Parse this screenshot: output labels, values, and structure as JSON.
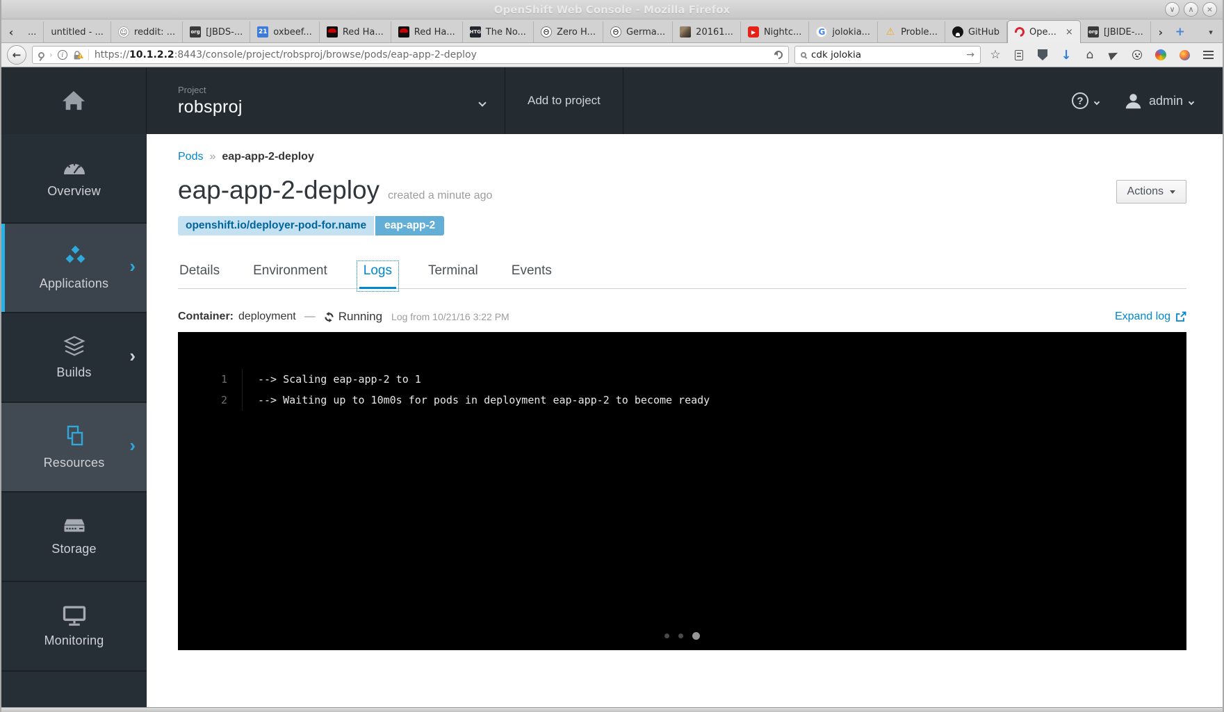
{
  "browser": {
    "window_title": "OpenShift Web Console - Mozilla Firefox",
    "window_controls": {
      "minimize": "∨",
      "maximize": "∧",
      "close": "×"
    },
    "tab_overflow": {
      "scroll_left": "‹",
      "scroll_right": "›",
      "new_tab": "+",
      "list_tabs": "▾"
    },
    "icon_glyphs": {
      "reddit": "☺",
      "jboss": "org",
      "calendar": "21",
      "htg": "HTG",
      "theta": "Θ",
      "youtube": "▶",
      "google": "G",
      "warning": "⚠"
    },
    "tabs": [
      {
        "label": "..."
      },
      {
        "label": "untitled - ..."
      },
      {
        "label": "reddit: ...",
        "icon": "reddit"
      },
      {
        "label": "[JBDS-...",
        "icon": "jboss"
      },
      {
        "label": "oxbeef...",
        "icon": "calendar"
      },
      {
        "label": "Red Ha...",
        "icon": "redhat"
      },
      {
        "label": "Red Ha...",
        "icon": "redhat"
      },
      {
        "label": "The No...",
        "icon": "htg"
      },
      {
        "label": "Zero H...",
        "icon": "theta"
      },
      {
        "label": "Germa...",
        "icon": "theta"
      },
      {
        "label": "20161...",
        "icon": "photo"
      },
      {
        "label": "Nightc...",
        "icon": "youtube"
      },
      {
        "label": "jolokia...",
        "icon": "google"
      },
      {
        "label": "Proble...",
        "icon": "warning"
      },
      {
        "label": "GitHub",
        "icon": "github"
      },
      {
        "label": "Ope...",
        "icon": "openshift",
        "active": true,
        "close": "×"
      },
      {
        "label": "[JBIDE-...",
        "icon": "jboss"
      }
    ],
    "toolbar": {
      "back": "←",
      "url_scheme": "https://",
      "url_host": "10.1.2.2",
      "url_path": ":8443/console/project/robsproj/browse/pods/eap-app-2-deploy",
      "search_value": "cdk jolokia",
      "search_go": "→",
      "star": "☆",
      "download": "↓",
      "home": "⌂"
    }
  },
  "console": {
    "header": {
      "project_eyebrow": "Project",
      "project_name": "robsproj",
      "add_to_project": "Add to project",
      "help_glyph": "?",
      "username": "admin"
    },
    "sidebar": {
      "items": [
        {
          "label": "Overview"
        },
        {
          "label": "Applications"
        },
        {
          "label": "Builds"
        },
        {
          "label": "Resources"
        },
        {
          "label": "Storage"
        },
        {
          "label": "Monitoring"
        }
      ]
    },
    "page": {
      "breadcrumb": {
        "link": "Pods",
        "separator": "»",
        "current": "eap-app-2-deploy"
      },
      "title": "eap-app-2-deploy",
      "created": "created a minute ago",
      "actions_button": "Actions",
      "label_key": "openshift.io/deployer-pod-for.name",
      "label_value": "eap-app-2",
      "tabs": [
        "Details",
        "Environment",
        "Logs",
        "Terminal",
        "Events"
      ],
      "active_tab": "Logs",
      "log_header": {
        "container_label": "Container:",
        "container_name": "deployment",
        "separator": "—",
        "status": "Running",
        "log_from": "Log from 10/21/16 3:22 PM",
        "expand_link": "Expand log"
      },
      "log_lines": [
        {
          "number": "1",
          "text": "--> Scaling eap-app-2 to 1"
        },
        {
          "number": "2",
          "text": "--> Waiting up to 10m0s for pods in deployment eap-app-2 to become ready"
        }
      ]
    }
  }
}
